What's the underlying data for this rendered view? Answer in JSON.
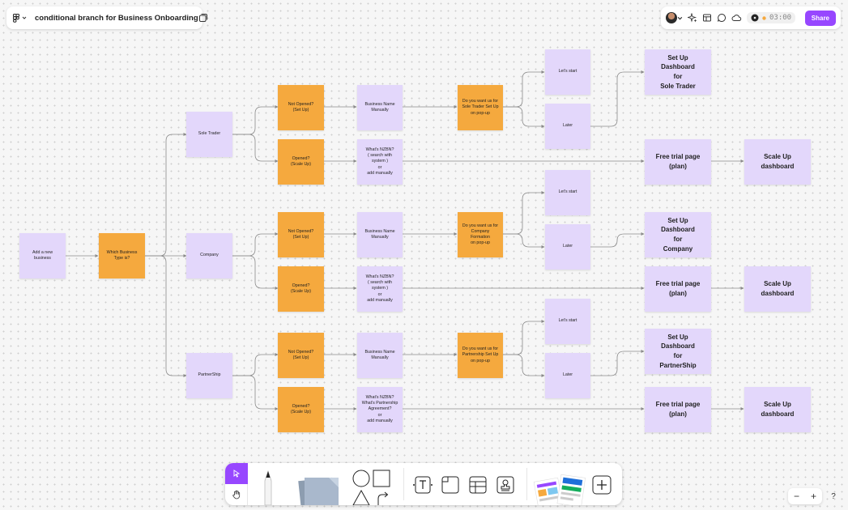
{
  "file": {
    "title": "conditional branch for Business Onboarding"
  },
  "toolbar_right": {
    "timer": "03:00",
    "share_label": "Share"
  },
  "zoom": {
    "out_label": "−",
    "in_label": "+",
    "help_label": "?"
  },
  "colors": {
    "purple": "#e3d7fb",
    "orange": "#f5a93e",
    "accent": "#9747ff",
    "connector": "#8a8a8a"
  },
  "flow": {
    "start": "Add a new\nbusiness",
    "which": "Which Business\nType is?",
    "branches": [
      {
        "type": "Sole Trader",
        "not_opened": "Not Opened?\n(Set Up)",
        "name_manually": "Business Name\nManually",
        "question": "Do you want us for\nSole Trader Set Up\non pop-up",
        "lets_start": "Let's start",
        "later": "Later",
        "dashboard": "Set Up\nDashboard\nfor\nSole Trader",
        "opened": "Opened?\n(Scale Up)",
        "nzbn": "What's NZBN?\n( search with\nsystem )\nor\nadd manually",
        "free_trial": "Free trial page\n(plan)",
        "scale_up": "Scale Up\ndashboard"
      },
      {
        "type": "Company",
        "not_opened": "Not Opened?\n(Set Up)",
        "name_manually": "Business Name\nManually",
        "question": "Do you want us for\nCompany\nFormation\non pop-up",
        "lets_start": "Let's start",
        "later": "Later",
        "dashboard": "Set Up\nDashboard\nfor\nCompany",
        "opened": "Opened?\n(Scale Up)",
        "nzbn": "What's NZBN?\n( search with\nsystem )\nor\nadd manually",
        "free_trial": "Free trial page\n(plan)",
        "scale_up": "Scale Up\ndashboard"
      },
      {
        "type": "PartnerShip",
        "not_opened": "Not Opened?\n(Set Up)",
        "name_manually": "Business Name\nManually",
        "question": "Do you want us for\nPartnership Set Up\non pop-up",
        "lets_start": "Let's start",
        "later": "Later",
        "dashboard": "Set Up\nDashboard\nfor\nPartnerShip",
        "opened": "Opened?\n(Scale Up)",
        "nzbn": "What's NZBN?\nWhat's Partnership\nAgreement?\nor\nadd manually",
        "free_trial": "Free trial page\n(plan)",
        "scale_up": "Scale Up\ndashboard"
      }
    ]
  }
}
